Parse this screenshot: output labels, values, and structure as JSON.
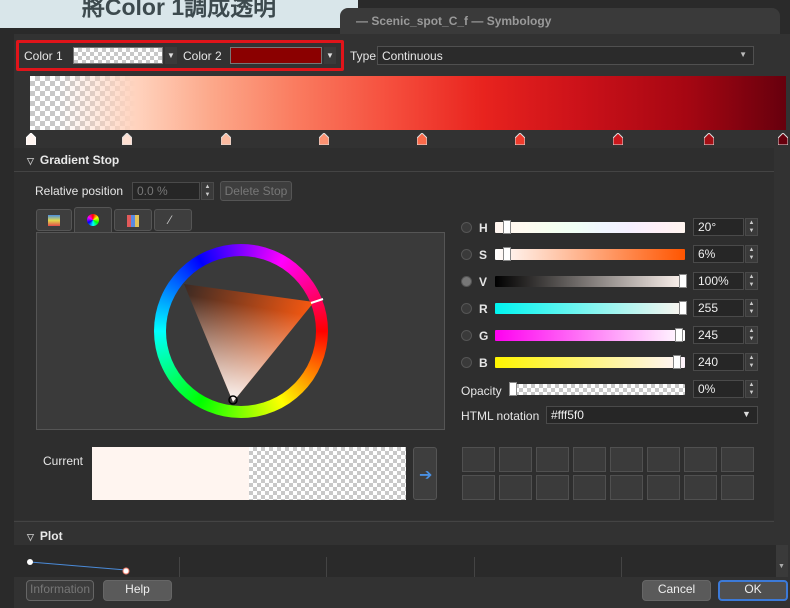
{
  "caption": "將Color 1調成透明",
  "window_title": "— Scenic_spot_C_f — Symbology",
  "top_row": {
    "color1_label": "Color 1",
    "color2_label": "Color 2",
    "type_label": "Type",
    "type_value": "Continuous"
  },
  "gradient_stop": {
    "section_title": "Gradient Stop",
    "relative_position_label": "Relative position",
    "relative_position_value": "0.0 %",
    "delete_stop_label": "Delete Stop"
  },
  "channels": [
    {
      "key": "H",
      "value": "20°"
    },
    {
      "key": "S",
      "value": "6%"
    },
    {
      "key": "V",
      "value": "100%"
    },
    {
      "key": "R",
      "value": "255"
    },
    {
      "key": "G",
      "value": "245"
    },
    {
      "key": "B",
      "value": "240"
    }
  ],
  "opacity": {
    "label": "Opacity",
    "value": "0%"
  },
  "html_notation": {
    "label": "HTML notation",
    "value": "#fff5f0"
  },
  "current_label": "Current",
  "plot": {
    "section_title": "Plot"
  },
  "buttons": {
    "information": "Information",
    "help": "Help",
    "cancel": "Cancel",
    "ok": "OK"
  },
  "colors": {
    "color2": "#8b0000",
    "current": "#fff5f0",
    "accent": "#e0141a"
  }
}
